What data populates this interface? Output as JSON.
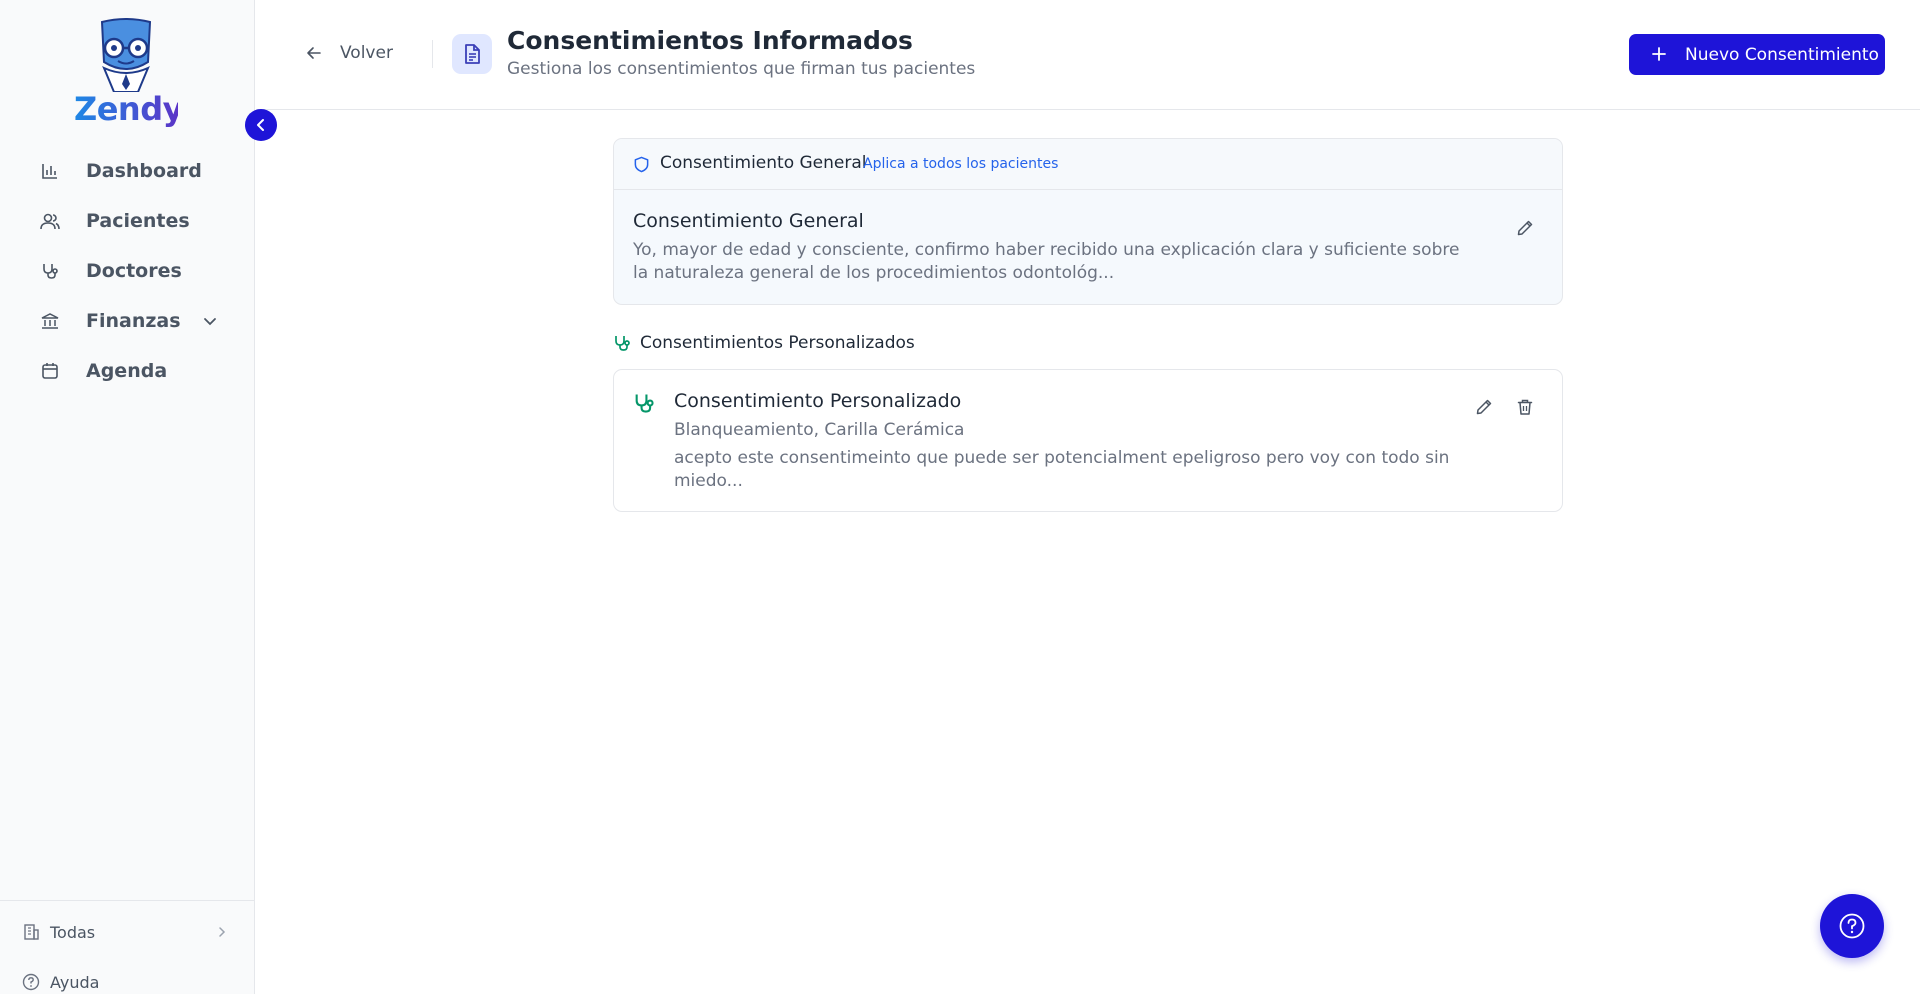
{
  "brand": {
    "name": "Zendy"
  },
  "sidebar": {
    "items": [
      {
        "label": "Dashboard",
        "icon": "bar-chart-icon"
      },
      {
        "label": "Pacientes",
        "icon": "users-icon"
      },
      {
        "label": "Doctores",
        "icon": "stethoscope-icon"
      },
      {
        "label": "Finanzas",
        "icon": "bank-icon",
        "has_submenu": true
      },
      {
        "label": "Agenda",
        "icon": "calendar-icon"
      }
    ],
    "bottom": {
      "clinic_selector": "Todas",
      "help": "Ayuda"
    }
  },
  "header": {
    "back_label": "Volver",
    "title": "Consentimientos Informados",
    "subtitle": "Gestiona los consentimientos que firman tus pacientes",
    "new_button_label": "Nuevo Consentimiento"
  },
  "general": {
    "section_title": "Consentimiento General",
    "tag": "Aplica a todos los pacientes",
    "title": "Consentimiento General",
    "text": "Yo, mayor de edad y consciente, confirmo haber recibido una explicación clara y suficiente sobre la naturaleza general de los procedimientos odontológ..."
  },
  "custom": {
    "section_title": "Consentimientos Personalizados",
    "items": [
      {
        "title": "Consentimiento Personalizado",
        "procedures": "Blanqueamiento, Carilla Cerámica",
        "text": "acepto este consentimeinto que puede ser potencialment epeligroso pero voy con todo sin miedo..."
      }
    ]
  },
  "colors": {
    "primary": "#1e14d8",
    "accent_blue": "#2563eb",
    "accent_green": "#059669",
    "text_muted": "#6b7280"
  }
}
